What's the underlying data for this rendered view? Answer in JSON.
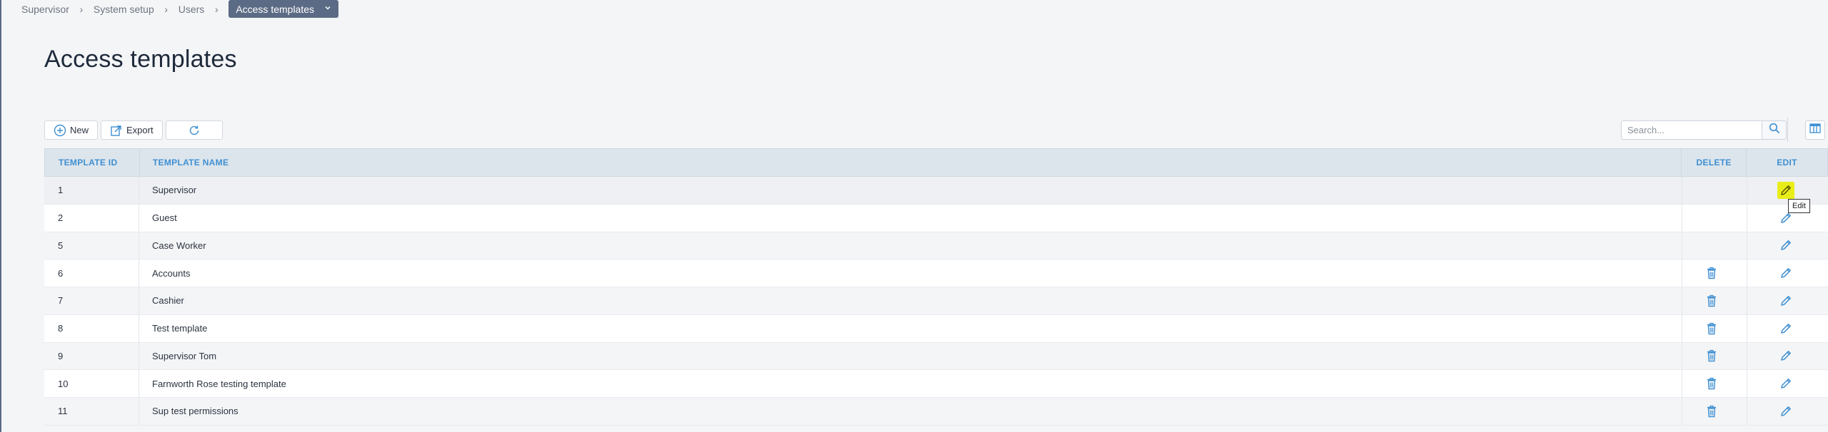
{
  "breadcrumb": {
    "items": [
      "Supervisor",
      "System setup",
      "Users"
    ],
    "current": "Access templates"
  },
  "page": {
    "title": "Access templates"
  },
  "toolbar": {
    "new_label": "New",
    "export_label": "Export"
  },
  "search": {
    "placeholder": "Search..."
  },
  "table": {
    "headers": {
      "id": "TEMPLATE ID",
      "name": "TEMPLATE NAME",
      "delete": "DELETE",
      "edit": "EDIT"
    },
    "rows": [
      {
        "id": "1",
        "name": "Supervisor",
        "deletable": false
      },
      {
        "id": "2",
        "name": "Guest",
        "deletable": false
      },
      {
        "id": "5",
        "name": "Case Worker",
        "deletable": false
      },
      {
        "id": "6",
        "name": "Accounts",
        "deletable": true
      },
      {
        "id": "7",
        "name": "Cashier",
        "deletable": true
      },
      {
        "id": "8",
        "name": "Test template",
        "deletable": true
      },
      {
        "id": "9",
        "name": "Supervisor Tom",
        "deletable": true
      },
      {
        "id": "10",
        "name": "Farnworth Rose testing template",
        "deletable": true
      },
      {
        "id": "11",
        "name": "Sup test permissions",
        "deletable": true
      }
    ]
  },
  "tooltip": {
    "text": "Edit"
  },
  "icons": {
    "new": "plus-circle-icon",
    "export": "export-icon",
    "refresh": "refresh-icon",
    "search": "search-icon",
    "columns": "columns-icon",
    "delete": "trash-icon",
    "edit": "pencil-icon"
  },
  "colors": {
    "accent": "#3f8fd1",
    "breadcrumb_active": "#5c6b85",
    "header_bg": "#dde5ec",
    "highlight": "#e9ee1a"
  }
}
